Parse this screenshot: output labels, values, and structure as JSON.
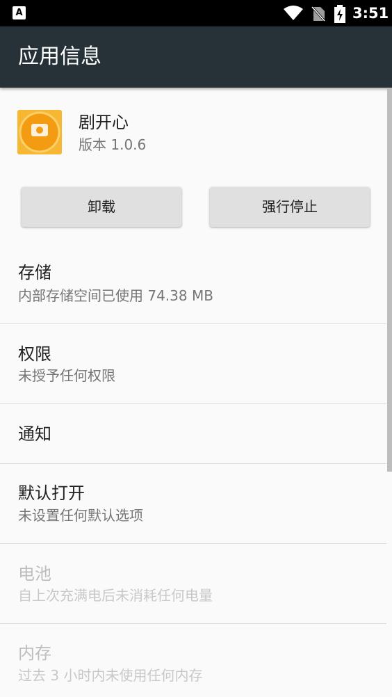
{
  "status_bar": {
    "notification_icon": "a-icon",
    "notification_letter": "A",
    "wifi_icon": "wifi-icon",
    "signal_icon": "no-sim-icon",
    "battery_icon": "battery-charging-icon",
    "time": "3:51"
  },
  "app_bar": {
    "title": "应用信息"
  },
  "app": {
    "icon": "app-icon",
    "icon_text": "剧开心",
    "name": "剧开心",
    "version": "版本 1.0.6"
  },
  "buttons": {
    "uninstall": "卸载",
    "force_stop": "强行停止"
  },
  "prefs": [
    {
      "title": "存储",
      "summary": "内部存储空间已使用 74.38 MB",
      "enabled": true
    },
    {
      "title": "权限",
      "summary": "未授予任何权限",
      "enabled": true
    },
    {
      "title": "通知",
      "summary": "",
      "enabled": true
    },
    {
      "title": "默认打开",
      "summary": "未设置任何默认选项",
      "enabled": true
    },
    {
      "title": "电池",
      "summary": "自上次充满电后未消耗任何电量",
      "enabled": false
    },
    {
      "title": "内存",
      "summary": "过去 3 小时内未使用任何内存",
      "enabled": false
    }
  ],
  "colors": {
    "app_bar": "#263238",
    "status_bar": "#000000",
    "background": "#fafafa",
    "button": "#e0e0e0",
    "app_icon": "#f5a623"
  }
}
